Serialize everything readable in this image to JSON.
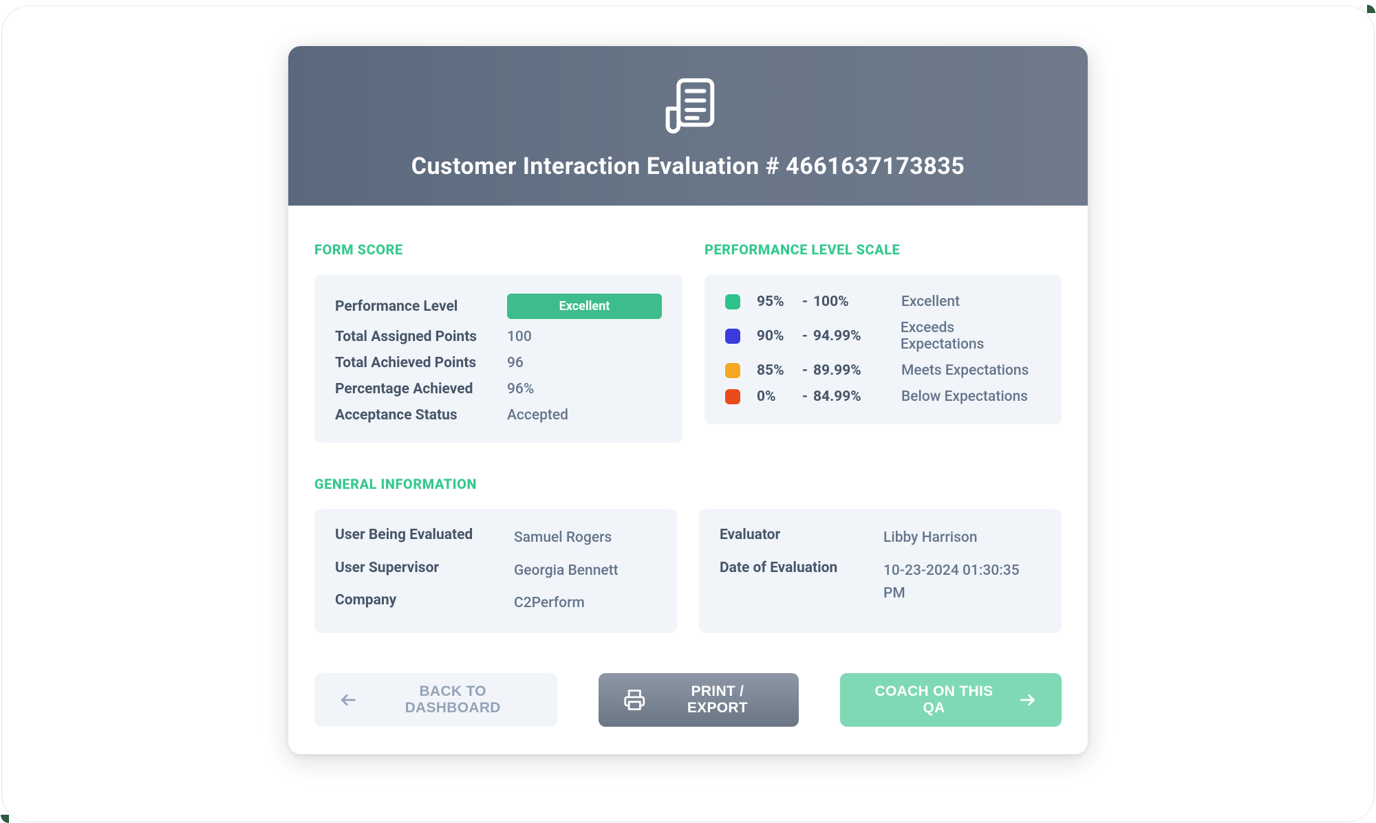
{
  "header": {
    "title": "Customer Interaction Evaluation # 4661637173835"
  },
  "sections": {
    "form_score_title": "FORM SCORE",
    "performance_scale_title": "PERFORMANCE LEVEL SCALE",
    "general_info_title": "GENERAL INFORMATION"
  },
  "form_score": {
    "performance_level_label": "Performance Level",
    "performance_level_badge": "Excellent",
    "total_assigned_label": "Total Assigned Points",
    "total_assigned_value": "100",
    "total_achieved_label": "Total Achieved Points",
    "total_achieved_value": "96",
    "percentage_label": "Percentage Achieved",
    "percentage_value": "96%",
    "acceptance_label": "Acceptance Status",
    "acceptance_value": "Accepted"
  },
  "scale": [
    {
      "color": "#2fc28b",
      "from": "95%",
      "to": "100%",
      "label": "Excellent"
    },
    {
      "color": "#3b3bdd",
      "from": "90%",
      "to": "94.99%",
      "label": "Exceeds Expectations"
    },
    {
      "color": "#f5a623",
      "from": "85%",
      "to": "89.99%",
      "label": "Meets Expectations"
    },
    {
      "color": "#e84b1c",
      "from": "0%",
      "to": "84.99%",
      "label": "Below Expectations"
    }
  ],
  "general": {
    "left": {
      "user_label": "User Being Evaluated",
      "user_value": "Samuel Rogers",
      "supervisor_label": "User Supervisor",
      "supervisor_value": "Georgia Bennett",
      "company_label": "Company",
      "company_value": "C2Perform"
    },
    "right": {
      "evaluator_label": "Evaluator",
      "evaluator_value": "Libby Harrison",
      "date_label": "Date of Evaluation",
      "date_value": "10-23-2024  01:30:35 PM"
    }
  },
  "actions": {
    "back": "BACK TO DASHBOARD",
    "print": "PRINT / EXPORT",
    "coach": "COACH ON THIS QA"
  },
  "dash": "-"
}
